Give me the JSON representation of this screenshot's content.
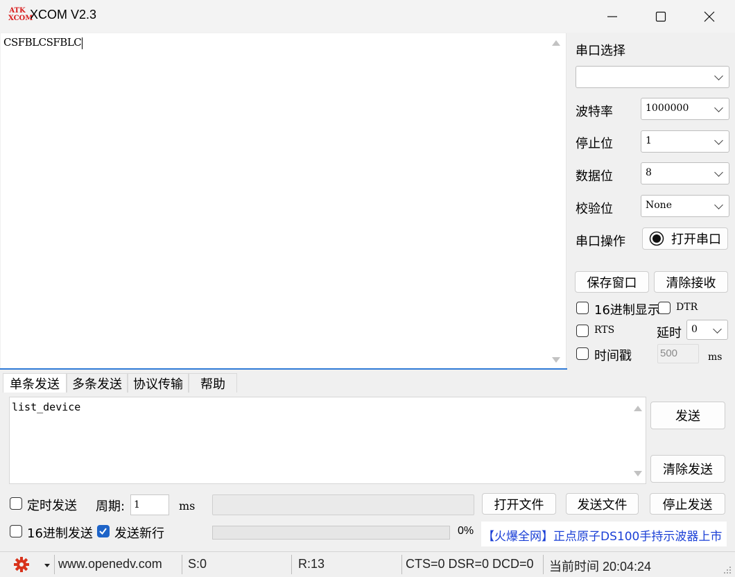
{
  "window": {
    "icon_text_top": "ATK",
    "icon_text_bottom": "XCOM",
    "title": "XCOM V2.3"
  },
  "receive": {
    "text": "CSFBLCSFBLC"
  },
  "panel": {
    "port_select_label": "串口选择",
    "port_value": "",
    "baud_label": "波特率",
    "baud_value": "1000000",
    "stop_label": "停止位",
    "stop_value": "1",
    "data_label": "数据位",
    "data_value": "8",
    "parity_label": "校验位",
    "parity_value": "None",
    "port_op_label": "串口操作",
    "open_port_button": "打开串口",
    "save_window_button": "保存窗口",
    "clear_receive_button": "清除接收",
    "hex_display_label": "16进制显示",
    "dtr_label": "DTR",
    "rts_label": "RTS",
    "delay_label": "延时",
    "delay_value": "0",
    "timestamp_label": "时间戳",
    "timestamp_value": "500",
    "timestamp_unit": "ms"
  },
  "tabs": [
    "单条发送",
    "多条发送",
    "协议传输",
    "帮助"
  ],
  "send": {
    "text": "list_device",
    "send_button": "发送",
    "clear_send_button": "清除发送",
    "timed_send_label": "定时发送",
    "period_label": "周期:",
    "period_value": "1",
    "period_unit": "ms",
    "open_file_button": "打开文件",
    "send_file_button": "发送文件",
    "stop_send_button": "停止发送",
    "hex_send_label": "16进制发送",
    "newline_label": "发送新行",
    "progress_percent": "0%",
    "progress_value": 0,
    "ad_link": "【火爆全网】正点原子DS100手持示波器上市"
  },
  "status": {
    "website": "www.openedv.com",
    "sent": "S:0",
    "received": "R:13",
    "signals": "CTS=0 DSR=0 DCD=0",
    "time": "当前时间 20:04:24"
  },
  "colors": {
    "accent": "#2f7ad6",
    "checkbox_checked": "#1e64c8",
    "link": "#1a3fd6",
    "gear": "#d8331c"
  }
}
